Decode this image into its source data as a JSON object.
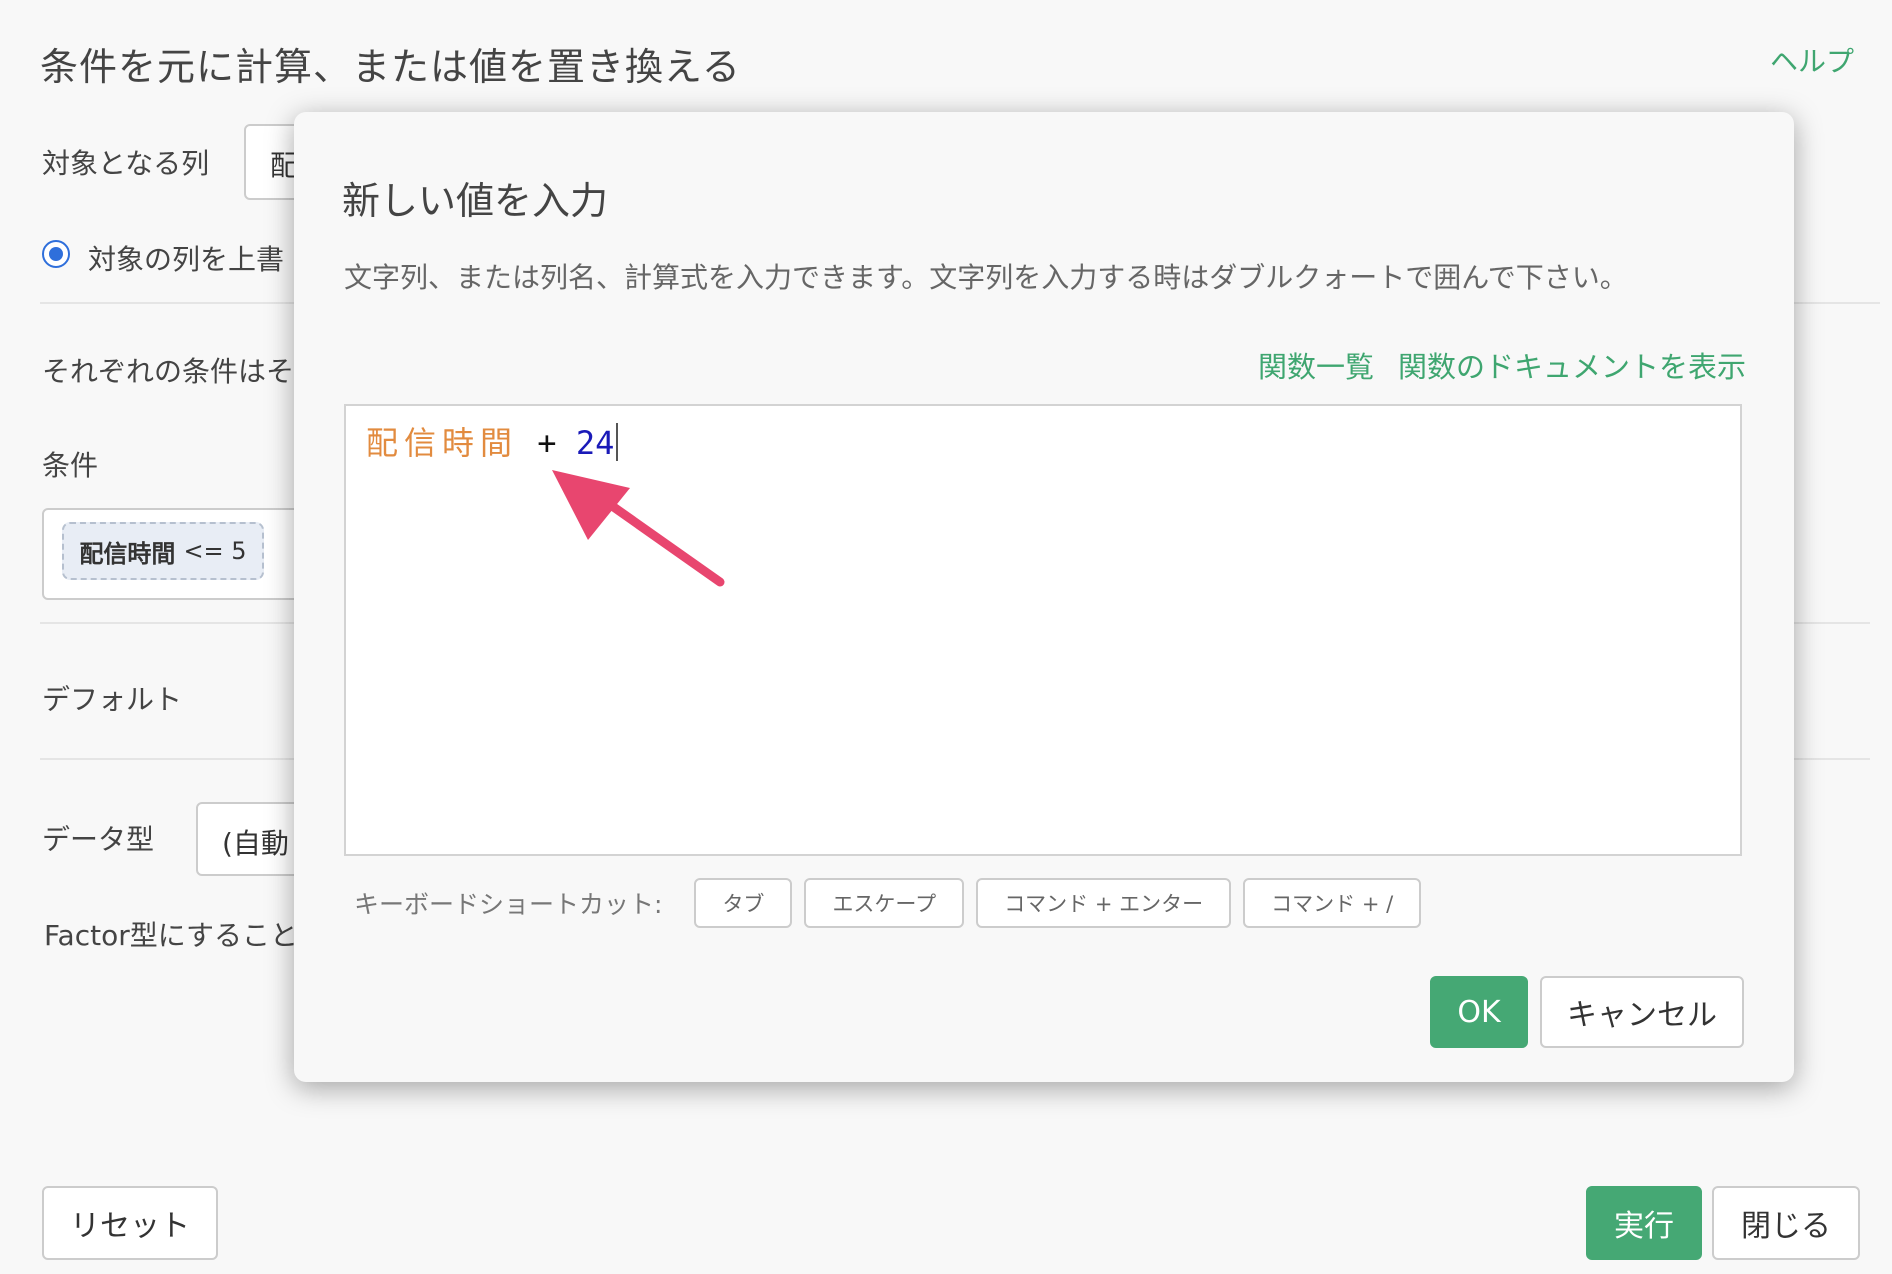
{
  "background": {
    "title": "条件を元に計算、または値を置き換える",
    "help_link": "ヘルプ",
    "target_column_label": "対象となる列",
    "target_column_value": "配",
    "overwrite_radio_label": "対象の列を上書",
    "conditions_instruction": "それぞれの条件はそ",
    "condition_label": "条件",
    "condition_chip": {
      "column": "配信時間",
      "operator": "<= 5"
    },
    "default_label": "デフォルト",
    "data_type_label": "データ型",
    "data_type_value": "(自動",
    "factor_note": "Factor型にすること",
    "reset_button": "リセット",
    "run_button": "実行",
    "close_button": "閉じる"
  },
  "modal": {
    "title": "新しい値を入力",
    "description": "文字列、または列名、計算式を入力できます。文字列を入力する時はダブルクォートで囲んで下さい。",
    "links": {
      "function_list": "関数一覧",
      "function_docs": "関数のドキュメントを表示"
    },
    "editor": {
      "token_column": "配信時間",
      "token_operator": "+",
      "token_number": "24"
    },
    "shortcuts": {
      "label": "キーボードショートカット:",
      "keys": [
        "タブ",
        "エスケープ",
        "コマンド + エンター",
        "コマンド + /"
      ]
    },
    "ok_button": "OK",
    "cancel_button": "キャンセル"
  },
  "colors": {
    "accent_green": "#45a874",
    "link_green": "#3fa670",
    "column_token": "#e28b3f",
    "number_token": "#1a1ab8",
    "annotation_arrow": "#e8466f",
    "radio_blue": "#2f6fdb"
  }
}
